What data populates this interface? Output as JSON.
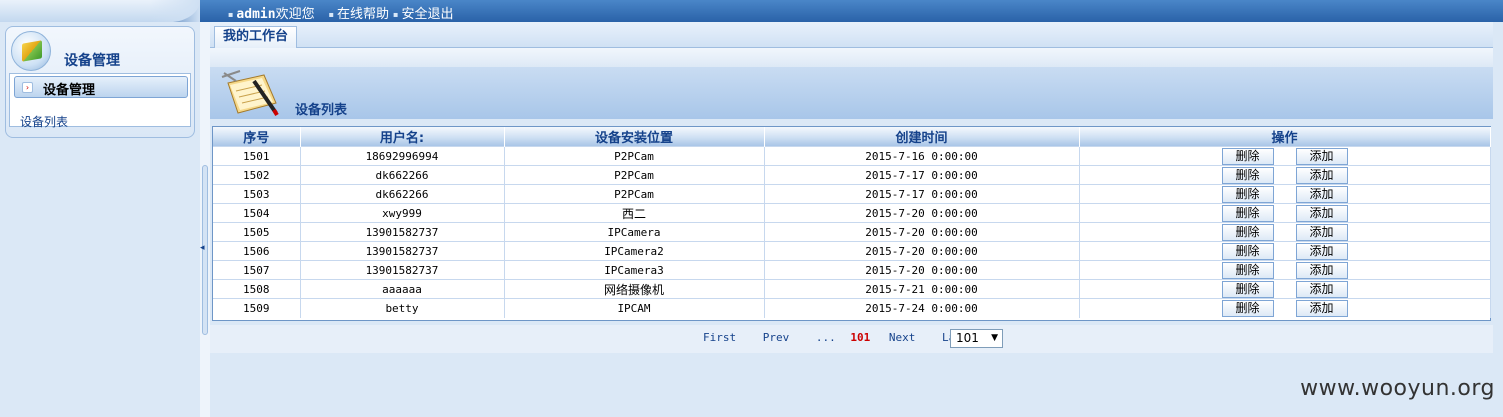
{
  "topbar": {
    "user": "admin",
    "welcome": "欢迎您",
    "help": "在线帮助",
    "logout": "安全退出"
  },
  "sidebar": {
    "title": "设备管理",
    "active_item": "设备管理",
    "sub_item": "设备列表"
  },
  "tabs": [
    {
      "label": "我的工作台"
    }
  ],
  "panel": {
    "title": "设备列表"
  },
  "table": {
    "headers": [
      "序号",
      "用户名:",
      "设备安装位置",
      "创建时间",
      "操作"
    ],
    "delete_label": "删除",
    "add_label": "添加",
    "rows": [
      {
        "id": "1501",
        "user": "18692996994",
        "location": "P2PCam",
        "created": "2015-7-16 0:00:00"
      },
      {
        "id": "1502",
        "user": "dk662266",
        "location": "P2PCam",
        "created": "2015-7-17 0:00:00"
      },
      {
        "id": "1503",
        "user": "dk662266",
        "location": "P2PCam",
        "created": "2015-7-17 0:00:00"
      },
      {
        "id": "1504",
        "user": "xwy999",
        "location": "西二",
        "created": "2015-7-20 0:00:00"
      },
      {
        "id": "1505",
        "user": "13901582737",
        "location": "IPCamera",
        "created": "2015-7-20 0:00:00"
      },
      {
        "id": "1506",
        "user": "13901582737",
        "location": "IPCamera2",
        "created": "2015-7-20 0:00:00"
      },
      {
        "id": "1507",
        "user": "13901582737",
        "location": "IPCamera3",
        "created": "2015-7-20 0:00:00"
      },
      {
        "id": "1508",
        "user": "aaaaaa",
        "location": "网络摄像机",
        "created": "2015-7-21 0:00:00"
      },
      {
        "id": "1509",
        "user": "betty",
        "location": "IPCAM",
        "created": "2015-7-24 0:00:00"
      }
    ]
  },
  "pager": {
    "first": "First",
    "prev": "Prev",
    "dots": "...",
    "current": "101",
    "next": "Next",
    "last": "Last",
    "selected_page": "101"
  },
  "watermark": "www.wooyun.org"
}
